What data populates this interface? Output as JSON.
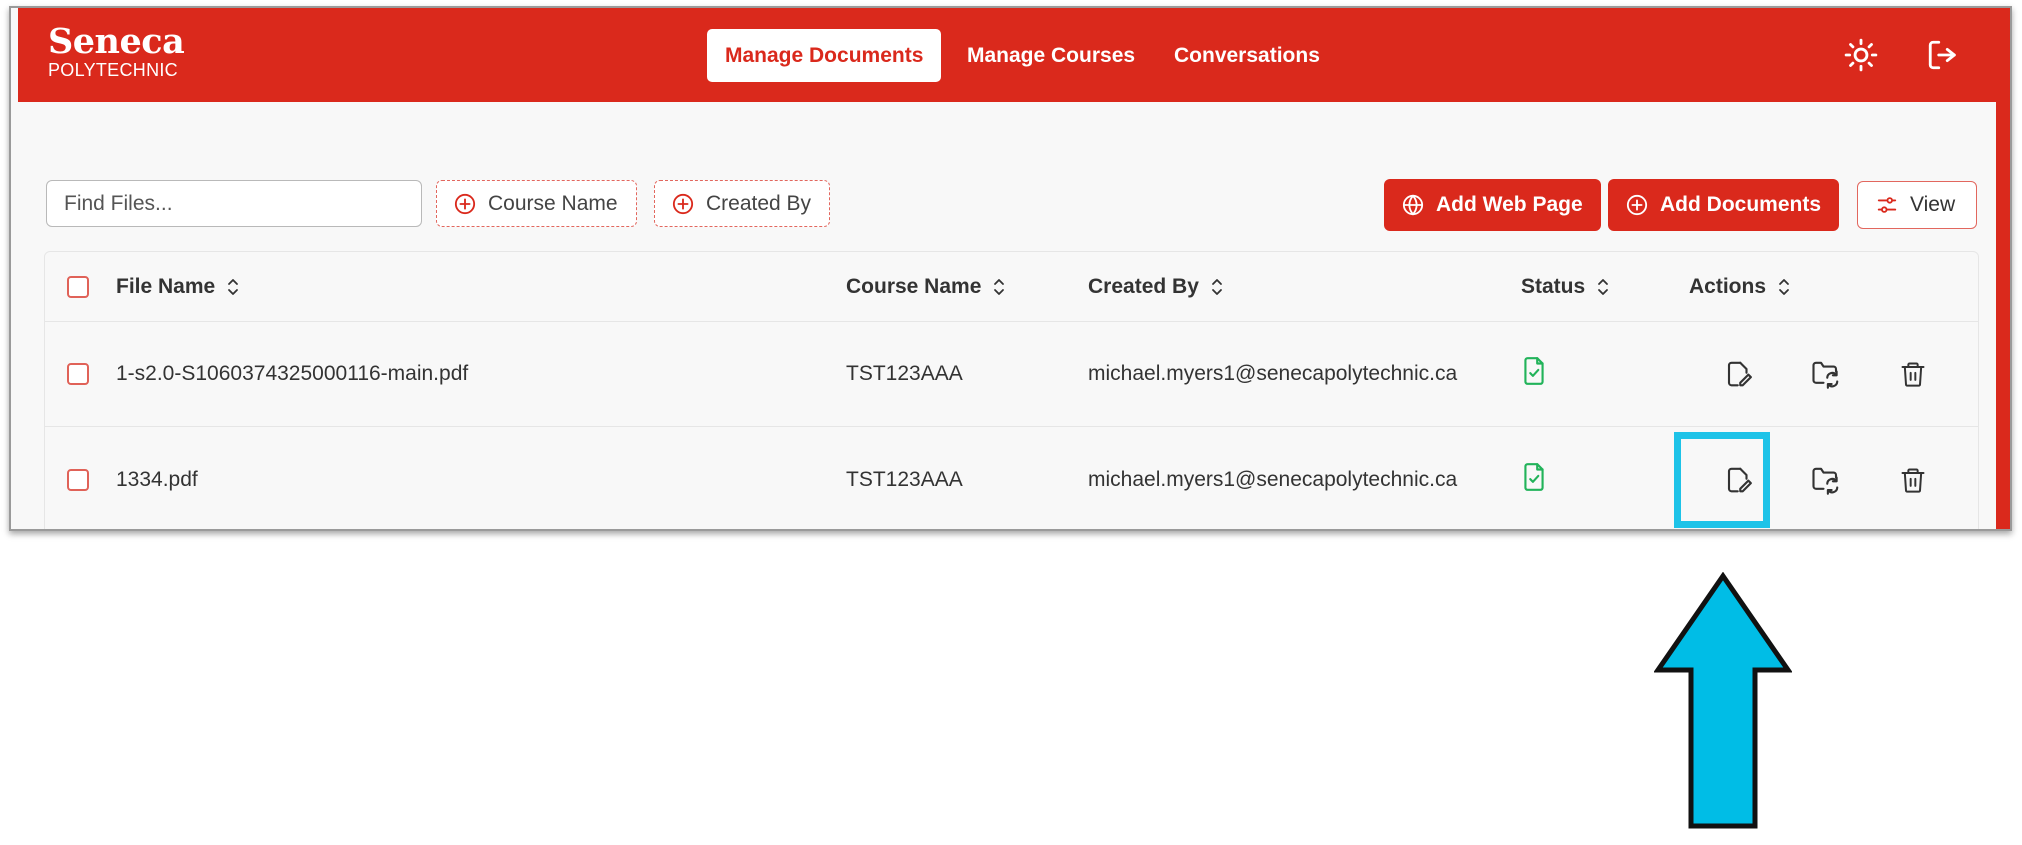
{
  "brand": {
    "name": "Seneca",
    "subtitle": "POLYTECHNIC",
    "color": "#da291c"
  },
  "nav": {
    "tabs": [
      {
        "label": "Manage Documents",
        "active": true
      },
      {
        "label": "Manage Courses",
        "active": false
      },
      {
        "label": "Conversations",
        "active": false
      }
    ],
    "icons": [
      "sun-icon",
      "logout-icon"
    ]
  },
  "toolbar": {
    "search_placeholder": "Find Files...",
    "filters": [
      "Course Name",
      "Created By"
    ],
    "add_web_page_label": "Add Web Page",
    "add_documents_label": "Add Documents",
    "view_label": "View"
  },
  "table": {
    "columns": [
      "File Name",
      "Course Name",
      "Created By",
      "Status",
      "Actions"
    ],
    "rows": [
      {
        "file_name": "1-s2.0-S1060374325000116-main.pdf",
        "course_name": "TST123AAA",
        "created_by": "michael.myers1@senecapolytechnic.ca",
        "status_icon": "file-check-icon",
        "actions": [
          "edit-icon",
          "folder-sync-icon",
          "trash-icon"
        ]
      },
      {
        "file_name": "1334.pdf",
        "course_name": "TST123AAA",
        "created_by": "michael.myers1@senecapolytechnic.ca",
        "status_icon": "file-check-icon",
        "actions": [
          "edit-icon",
          "folder-sync-icon",
          "trash-icon"
        ]
      }
    ]
  },
  "annotation": {
    "highlight_color": "#1ec3e8",
    "target": "edit-icon (row 2)",
    "arrow_direction": "up"
  }
}
